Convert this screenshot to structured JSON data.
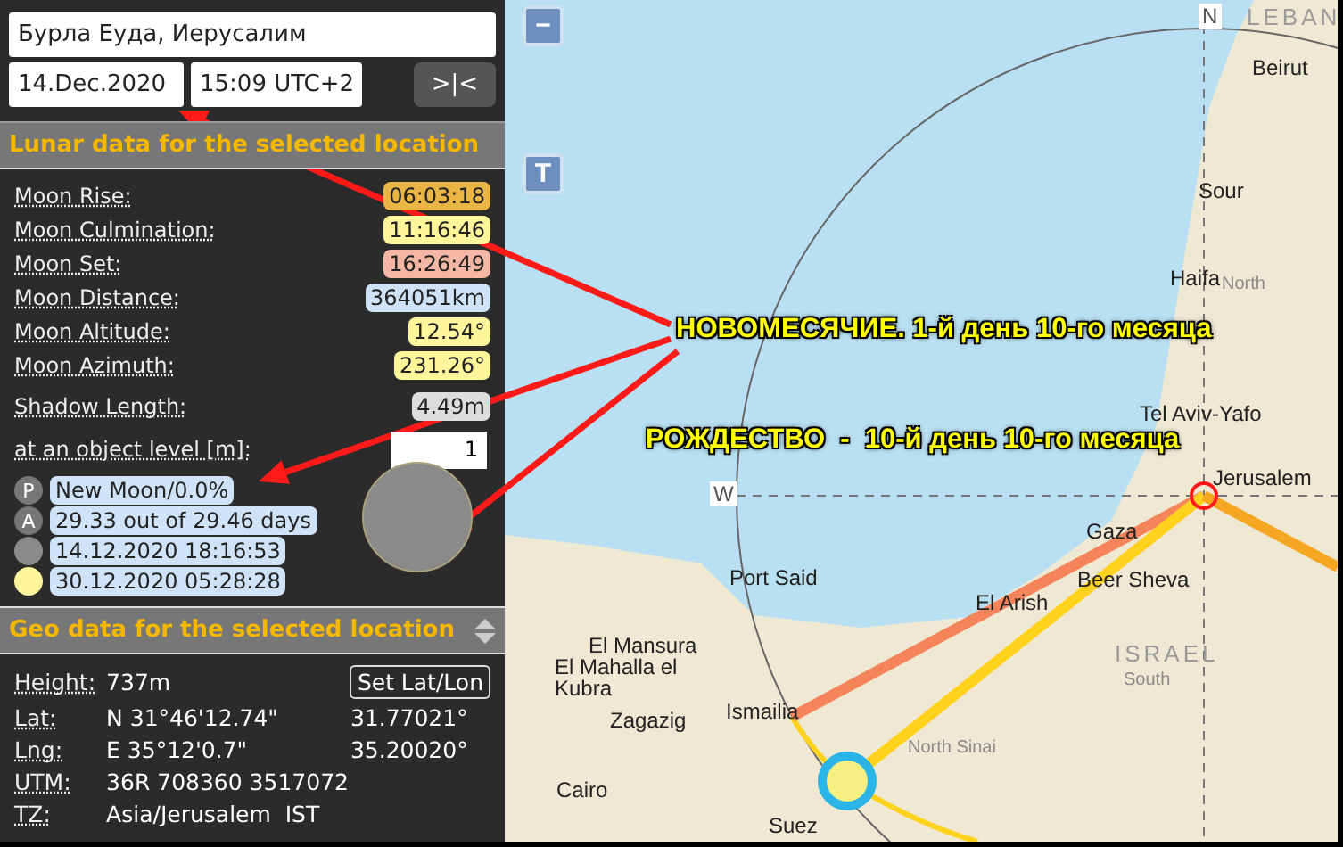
{
  "location": {
    "value": "Бурла Еуда, Иерусалим"
  },
  "date": {
    "value": "14.Dec.2020"
  },
  "time": {
    "value": "15:09 UTC+2"
  },
  "sync_button": ">|<",
  "lunar_header": "Lunar data for the selected location",
  "lunar_rows": [
    {
      "label": "Moon Rise:",
      "value": "06:03:18",
      "color": "#e9b545"
    },
    {
      "label": "Moon Culmination:",
      "value": "11:16:46",
      "color": "#fff59b"
    },
    {
      "label": "Moon Set:",
      "value": "16:26:49",
      "color": "#f5b7a5"
    },
    {
      "label": "Moon Distance:",
      "value": "364051km",
      "color": "#cfe3f8"
    },
    {
      "label": "Moon Altitude:",
      "value": "12.54°",
      "color": "#fff59b"
    },
    {
      "label": "Moon Azimuth:",
      "value": "231.26°",
      "color": "#fff59b"
    },
    {
      "label": "Shadow Length:",
      "value": "4.49m",
      "color": "#dddddd"
    }
  ],
  "object_level": {
    "label": "at an object level [m]:",
    "value": "1"
  },
  "phase_rows": [
    {
      "kind": "letter",
      "icon": "P",
      "text": "New Moon/0.0%"
    },
    {
      "kind": "letter",
      "icon": "A",
      "text": "29.33 out of 29.46 days"
    },
    {
      "kind": "dark",
      "text": "14.12.2020 18:16:53"
    },
    {
      "kind": "full",
      "text": "30.12.2020 05:28:28"
    }
  ],
  "geo_header": "Geo data for the selected location",
  "geo_rows": [
    {
      "label": "Height:",
      "value": "737m"
    },
    {
      "label": "Lat:",
      "value": "N 31°46'12.74\"",
      "decimal": "31.77021°"
    },
    {
      "label": "Lng:",
      "value": "E 35°12'0.7\"",
      "decimal": "35.20020°"
    },
    {
      "label": "UTM:",
      "value": "36R 708360 3517072"
    },
    {
      "label": "TZ:",
      "value": "Asia/Jerusalem  IST"
    }
  ],
  "set_button": "Set Lat/Lon",
  "map": {
    "zoom_out": "−",
    "tool_button": "T",
    "labels": [
      {
        "kind": "compass",
        "text": "N"
      },
      {
        "kind": "country",
        "text": "LEBAN"
      },
      {
        "kind": "city",
        "text": "Beirut"
      },
      {
        "kind": "city",
        "text": "Sour"
      },
      {
        "kind": "city",
        "text": "Haifa"
      },
      {
        "kind": "region",
        "text": "North"
      },
      {
        "kind": "city",
        "text": "Tel Aviv-Yafo"
      },
      {
        "kind": "compass",
        "text": "W"
      },
      {
        "kind": "city",
        "text": "Jerusalem"
      },
      {
        "kind": "city",
        "text": "Gaza"
      },
      {
        "kind": "city",
        "text": "Beer Sheva"
      },
      {
        "kind": "city",
        "text": "El Arish"
      },
      {
        "kind": "city",
        "text": "Port Said"
      },
      {
        "kind": "country",
        "text": "ISRAEL"
      },
      {
        "kind": "region",
        "text": "South"
      },
      {
        "kind": "region",
        "text": "North Sinai"
      },
      {
        "kind": "city",
        "text": "Ismailia"
      },
      {
        "kind": "city",
        "text": "El Mansura"
      },
      {
        "kind": "city",
        "text": "El Mahalla el Kubra"
      },
      {
        "kind": "city",
        "text": "Zagazig"
      },
      {
        "kind": "city",
        "text": "Cairo"
      },
      {
        "kind": "city",
        "text": "Suez"
      }
    ]
  },
  "annotations": [
    {
      "text": "НОВОМЕСЯЧИЕ. 1-й день 10-го месяца"
    },
    {
      "text": "РОЖДЕСТВО  -  10-й день 10-го месяца"
    }
  ]
}
